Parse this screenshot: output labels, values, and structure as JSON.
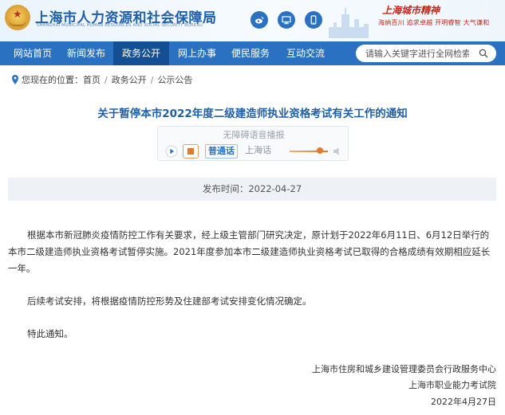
{
  "header": {
    "site_title": "上海市人力资源和社会保障局",
    "site_subtitle": "SHANGHAI MUNICIPAL HUMAN RESOURCES AND SOCIAL SECURITY BUREAU",
    "spirit_title": "上海城市精神",
    "spirit_subtitle": "海纳百川 追求卓越 开明睿智 大气谦和",
    "icons": [
      "weibo-icon",
      "monitor-icon",
      "mobile-icon"
    ]
  },
  "nav": {
    "items": [
      "网站首页",
      "新闻发布",
      "政务公开",
      "网上办事",
      "便民服务",
      "互动交流"
    ],
    "active": "政务公开",
    "search_placeholder": "请输入关键字进行全网检索"
  },
  "breadcrumb": {
    "label": "您现在的位置：",
    "items": [
      "首页",
      "政务公开",
      "公示公告"
    ]
  },
  "article": {
    "title": "关于暂停本市2022年度二级建造师执业资格考试有关工作的通知",
    "publish_time": "发布时间：2022-04-27",
    "paragraphs": [
      "根据本市新冠肺炎疫情防控工作有关要求，经上级主管部门研究决定，原计划于2022年6月11日、6月12日举行的本市二级建造师执业资格考试暂停实施。2021年度参加本市二级建造师执业资格考试已取得的合格成绩有效期相应延长一年。",
      "后续考试安排，将根据疫情防控形势及住建部考试安排变化情况确定。",
      "特此通知。"
    ],
    "signatures": [
      "上海市住房和城乡建设管理委员会行政服务中心",
      "上海市职业能力考试院",
      "2022年4月27日"
    ]
  },
  "player": {
    "label": "无障碍语音播报",
    "option_mandarin": "普通话",
    "option_shanghainese": "上海话"
  },
  "colors": {
    "brand_blue": "#2a72c1",
    "nav_active": "#154f93",
    "title_blue": "#1f5fa8",
    "spirit_red": "#c8261c",
    "accent_orange": "#e27a2c"
  }
}
